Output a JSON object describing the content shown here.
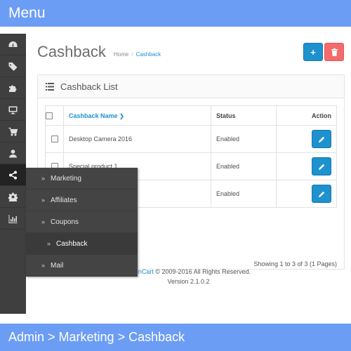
{
  "banner": {
    "top": "Menu",
    "bottom": "Admin > Marketing > Cashback"
  },
  "sidebar": {
    "icons": [
      "dashboard-icon",
      "tags-icon",
      "puzzle-icon",
      "desktop-icon",
      "cart-icon",
      "user-icon",
      "share-icon",
      "gear-icon",
      "bar-chart-icon"
    ],
    "active_index": 6
  },
  "flyout": {
    "items": [
      {
        "label": "Marketing",
        "sub": false
      },
      {
        "label": "Affiliates",
        "sub": false
      },
      {
        "label": "Coupons",
        "sub": false
      },
      {
        "label": "Cashback",
        "sub": true
      },
      {
        "label": "Mail",
        "sub": false
      }
    ]
  },
  "page": {
    "title": "Cashback",
    "breadcrumb": {
      "home": "Home",
      "current": "Cashback"
    },
    "add_button": "+"
  },
  "panel": {
    "heading": "Cashback List",
    "columns": {
      "name": "Cashback Name",
      "status": "Status",
      "action": "Action"
    },
    "rows": [
      {
        "name": "Desktop Camera 2016",
        "status": "Enabled"
      },
      {
        "name": "Special product 1",
        "status": "Enabled"
      },
      {
        "name": "",
        "status": "Enabled"
      }
    ],
    "showing": "Showing 1 to 3 of 3 (1 Pages)"
  },
  "footer": {
    "brand": "OpenCart",
    "copyright": " © 2009-2016 All Rights Reserved.",
    "version": "Version 2.1.0.2"
  },
  "colors": {
    "banner": "#6c9df5",
    "sidebar": "#3f3f3f",
    "primary": "#1e91cf",
    "danger": "#f56b6b"
  }
}
